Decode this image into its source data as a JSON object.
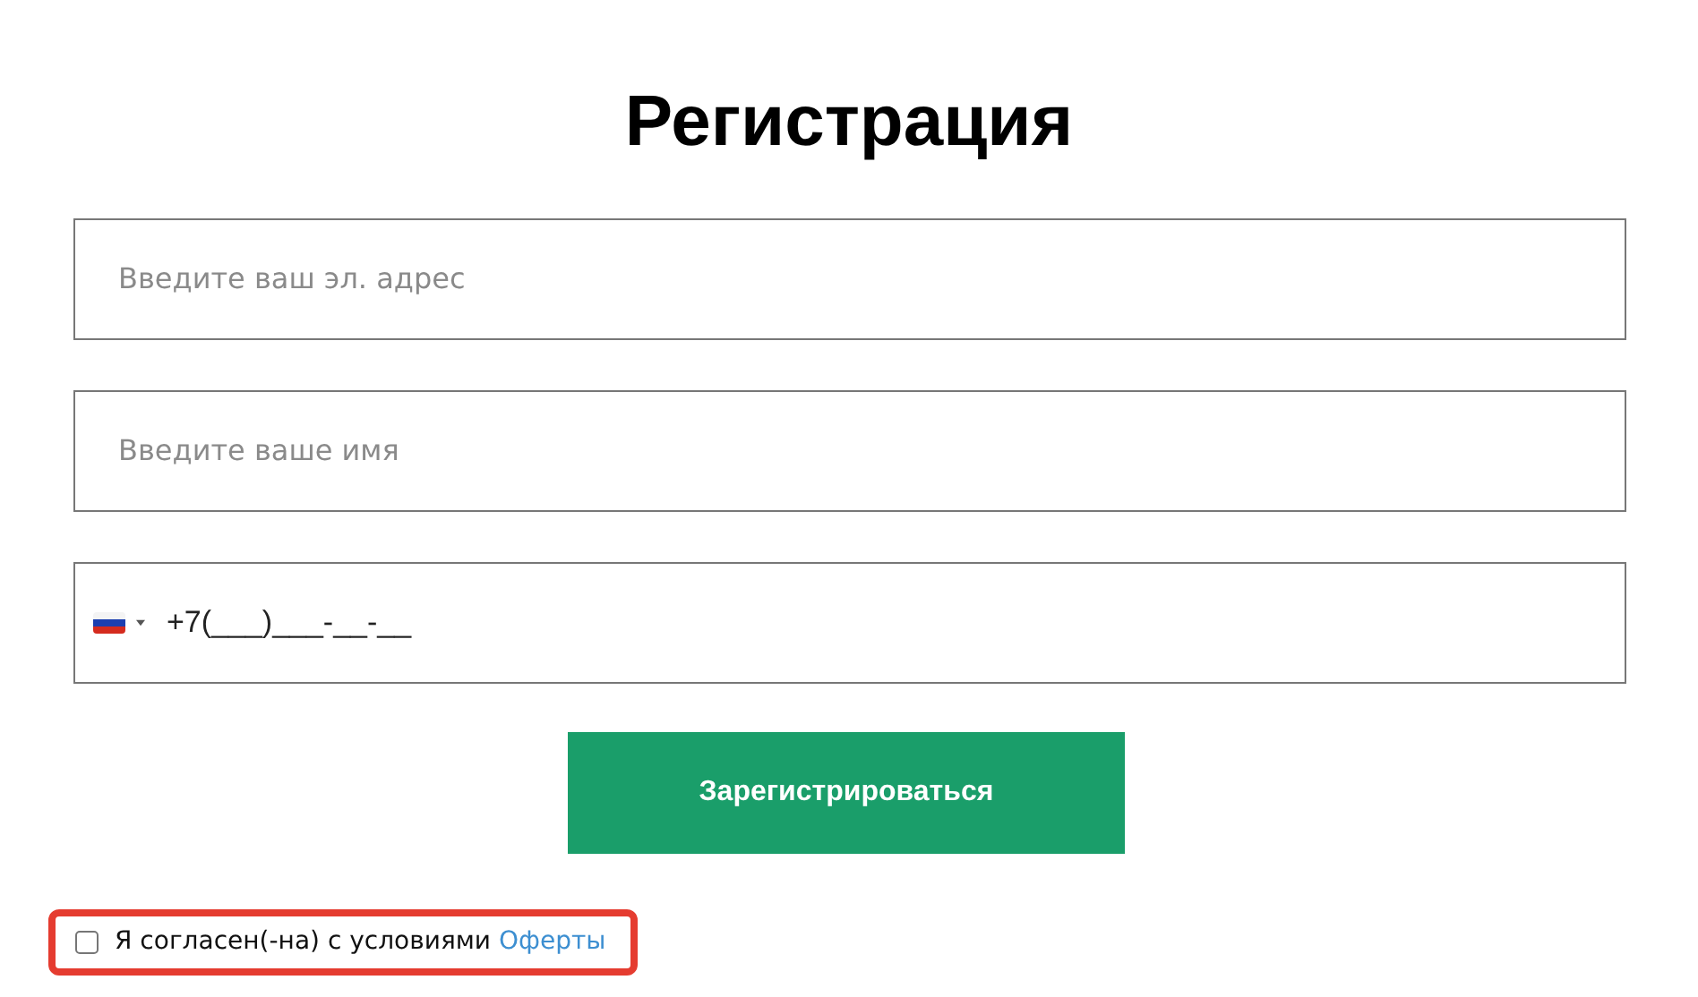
{
  "title": "Регистрация",
  "fields": [
    {
      "kind": "text",
      "placeholder": "Введите ваш эл. адрес"
    },
    {
      "kind": "text",
      "placeholder": "Введите ваше имя"
    },
    {
      "kind": "phone",
      "value": "+7(___)___-__-__"
    }
  ],
  "submit": "Зарегистрироваться",
  "agreement": {
    "checked": false,
    "text": "Я согласен(-на) с условиями",
    "link": "Оферты",
    "highlighted": true
  }
}
